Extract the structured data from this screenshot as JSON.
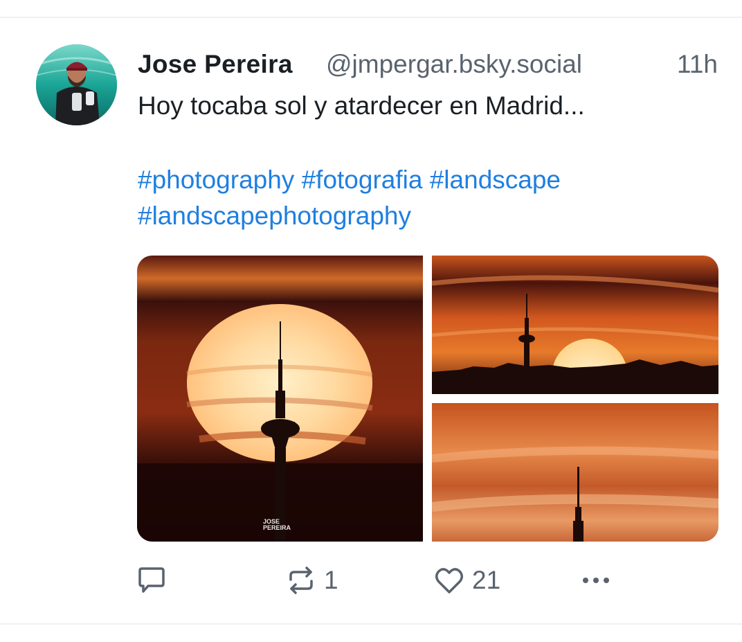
{
  "post": {
    "author": {
      "display_name": "Jose Pereira",
      "handle": "@jmpergar.bsky.social",
      "avatar_icon": "user-avatar-photo"
    },
    "timestamp": "11h",
    "text": "Hoy tocaba sol y atardecer en Madrid...",
    "hashtags": [
      "#photography",
      "#fotografia",
      "#landscape",
      "#landscapephotography"
    ],
    "media": [
      {
        "description": "Sun setting behind Torrespaña tower silhouette",
        "watermark_line1": "JOSE",
        "watermark_line2": "PEREIRA"
      },
      {
        "description": "Sunset over Madrid skyline with tower"
      },
      {
        "description": "Tower tip against orange clouds"
      }
    ],
    "actions": {
      "reply": {
        "icon": "reply-icon",
        "count": ""
      },
      "repost": {
        "icon": "repost-icon",
        "count": "1"
      },
      "like": {
        "icon": "heart-icon",
        "count": "21"
      },
      "more": {
        "icon": "more-options-icon"
      }
    }
  },
  "colors": {
    "link": "#1f7fe0",
    "secondary_text": "#59636e",
    "primary_text": "#1a1f24"
  }
}
